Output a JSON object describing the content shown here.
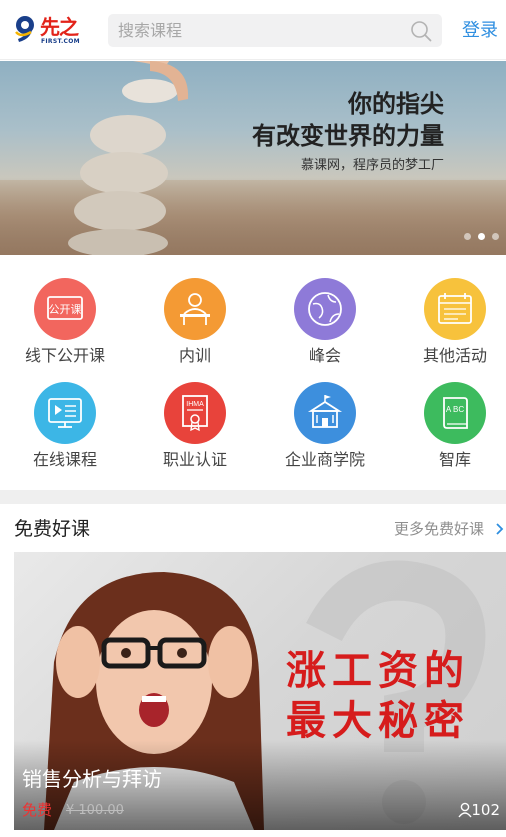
{
  "header": {
    "logo_cn": "先之",
    "logo_en": "FIRST.COM",
    "search_placeholder": "搜索课程",
    "login": "登录"
  },
  "banner": {
    "line1": "你的指尖",
    "line2": "有改变世界的力量",
    "sub": "慕课网，程序员的梦工厂",
    "slides": 3,
    "active_slide": 2
  },
  "grid": [
    {
      "label": "线下公开课",
      "icon": "open-class-icon",
      "color": "#f2665e",
      "badge": "公开课"
    },
    {
      "label": "内训",
      "icon": "training-icon",
      "color": "#f49a34"
    },
    {
      "label": "峰会",
      "icon": "summit-icon",
      "color": "#8e7ad8"
    },
    {
      "label": "其他活动",
      "icon": "calendar-icon",
      "color": "#f7c23c"
    },
    {
      "label": "在线课程",
      "icon": "online-course-icon",
      "color": "#3cb6e6"
    },
    {
      "label": "职业认证",
      "icon": "certificate-icon",
      "color": "#e8433b",
      "badge": "IHMA"
    },
    {
      "label": "企业商学院",
      "icon": "academy-icon",
      "color": "#3d8fdd"
    },
    {
      "label": "智库",
      "icon": "library-icon",
      "color": "#3dbb5e",
      "badge": "A BC"
    }
  ],
  "section": {
    "title": "免费好课",
    "more": "更多免费好课"
  },
  "course": {
    "poster_line1": "涨工资的",
    "poster_line2": "最大秘密",
    "title": "销售分析与拜访",
    "price": "免费",
    "original_price": "¥ 100.00",
    "learners": "102"
  },
  "colors": {
    "brand_red": "#e2231a",
    "brand_blue": "#1a3f8a",
    "link": "#2e8ee0"
  }
}
